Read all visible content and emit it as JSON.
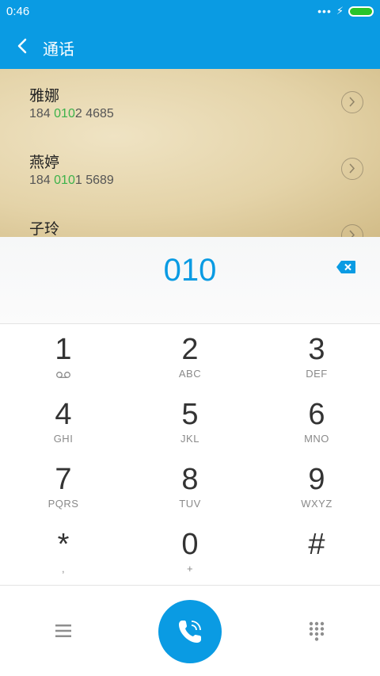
{
  "status_bar": {
    "time": "0:46",
    "more_icon": "dots-icon",
    "charging_icon": "bolt-icon",
    "battery_color": "#29c42a"
  },
  "title_bar": {
    "title": "通话",
    "back_icon": "back-arrow-icon"
  },
  "colors": {
    "accent": "#0a9be3",
    "match_highlight": "#3cb24a"
  },
  "results": [
    {
      "name": "雅娜",
      "num_before": "184 ",
      "num_match": "010",
      "num_after": "2 4685"
    },
    {
      "name": "燕婷",
      "num_before": "184 ",
      "num_match": "010",
      "num_after": "1 5689"
    },
    {
      "name": "子玲",
      "num_before": "",
      "num_match": "",
      "num_after": ""
    }
  ],
  "input": {
    "digits": "010",
    "delete_icon": "backspace-icon"
  },
  "keypad": {
    "keys": [
      {
        "num": "1",
        "sub": ""
      },
      {
        "num": "2",
        "sub": "ABC"
      },
      {
        "num": "3",
        "sub": "DEF"
      },
      {
        "num": "4",
        "sub": "GHI"
      },
      {
        "num": "5",
        "sub": "JKL"
      },
      {
        "num": "6",
        "sub": "MNO"
      },
      {
        "num": "7",
        "sub": "PQRS"
      },
      {
        "num": "8",
        "sub": "TUV"
      },
      {
        "num": "9",
        "sub": "WXYZ"
      },
      {
        "num": "*",
        "sub": ","
      },
      {
        "num": "0",
        "sub": "+"
      },
      {
        "num": "#",
        "sub": ""
      }
    ],
    "voicemail_icon": "voicemail-icon"
  },
  "bottom_bar": {
    "menu_icon": "menu-icon",
    "call_icon": "phone-icon",
    "dialpad_icon": "dialpad-icon"
  }
}
